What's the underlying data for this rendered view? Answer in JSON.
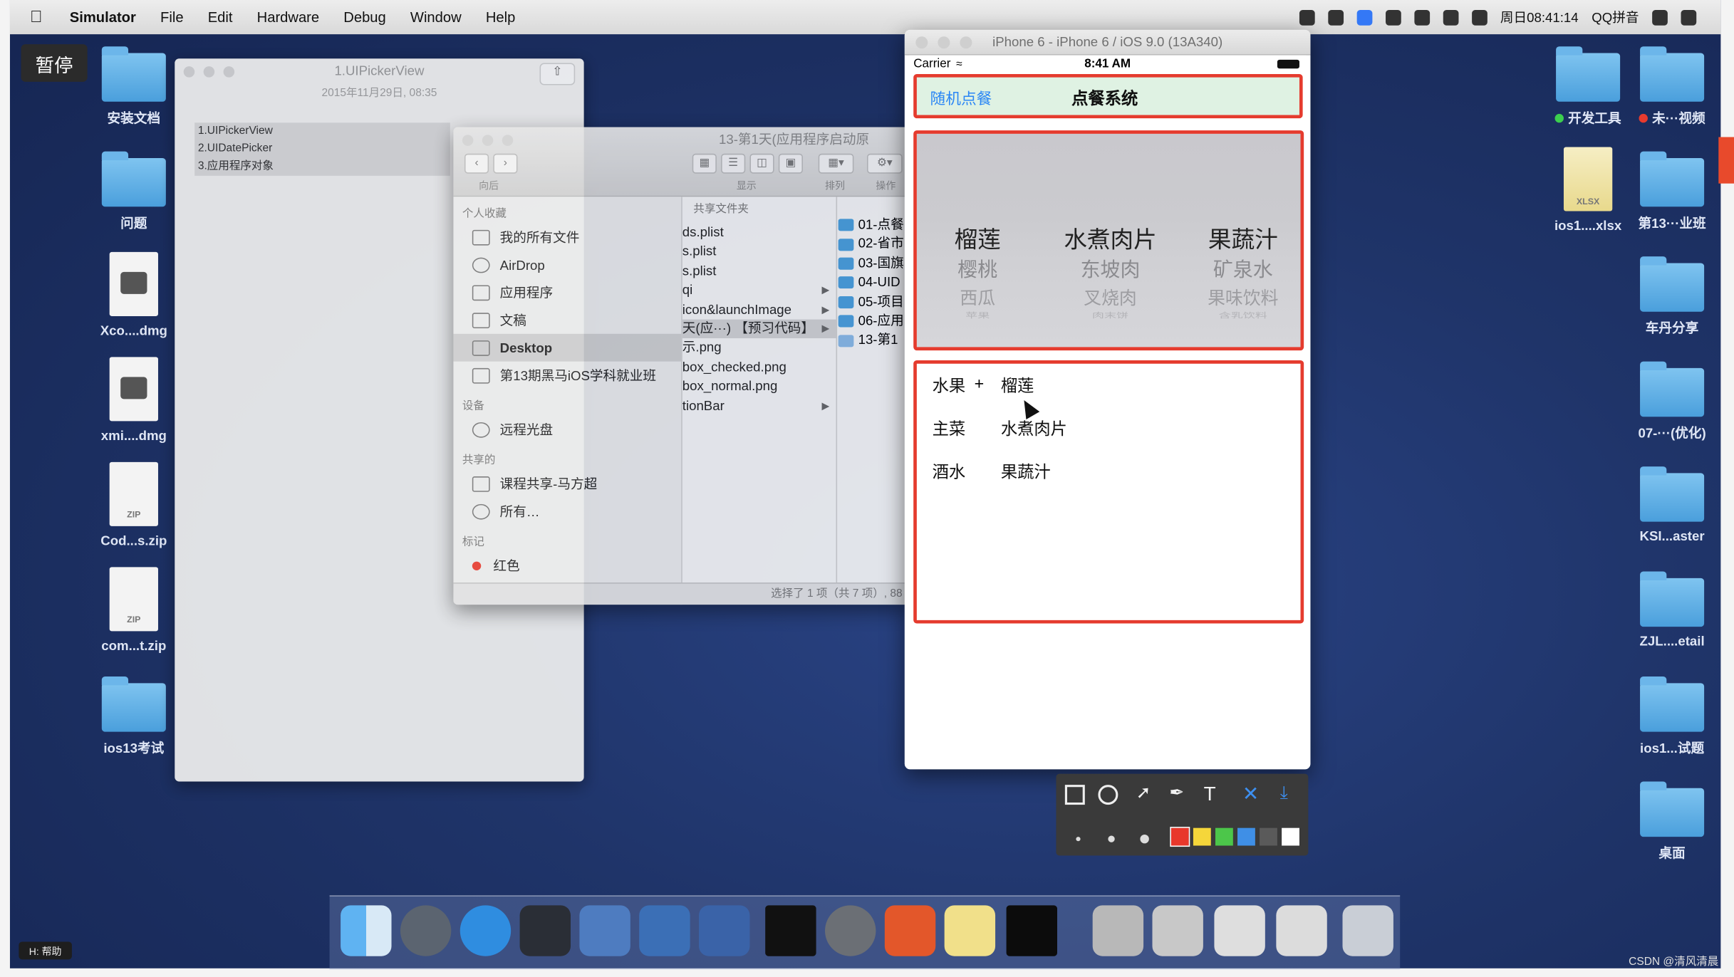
{
  "menubar": {
    "app": "Simulator",
    "items": [
      "File",
      "Edit",
      "Hardware",
      "Debug",
      "Window",
      "Help"
    ],
    "clock": "周日08:41:14",
    "input_method": "QQ拼音"
  },
  "overlay": {
    "pause_label": "暂停",
    "help_label": "H: 帮助"
  },
  "desktop_left": [
    "安装文档",
    "问题",
    "Xco....dmg",
    "xmi....dmg",
    "Cod...s.zip",
    "com...t.zip",
    "ios13考试"
  ],
  "desktop_right": {
    "tag_dev": "开发工具",
    "tag_video": "未···视频",
    "xlsx_icon_label": "XLSX",
    "xlsx_name": "ios1....xlsx",
    "folder_13": "第13···业班",
    "others": [
      "车丹分享",
      "07-···(优化)",
      "KSI...aster",
      "ZJL....etail",
      "ios1...试题",
      "桌面"
    ]
  },
  "notes": {
    "title": "1.UIPickerView",
    "date": "2015年11月29日, 08:35",
    "lines": [
      "1.UIPickerView",
      "2.UIDatePicker",
      "3.应用程序对象"
    ]
  },
  "finder": {
    "title": "13-第1天(应用程序启动原",
    "toolbar_captions": [
      "向后",
      "显示",
      "排列",
      "操作"
    ],
    "favorites_header": "个人收藏",
    "favorites": [
      "我的所有文件",
      "AirDrop",
      "应用程序",
      "文稿",
      "Desktop",
      "第13期黑马iOS学科就业班"
    ],
    "devices_header": "设备",
    "devices": [
      "远程光盘"
    ],
    "shared_header": "共享的",
    "shared": [
      "课程共享-马方超",
      "所有…"
    ],
    "tags_header": "标记",
    "tags": [
      "红色"
    ],
    "column_header": "共享文件夹",
    "col2": [
      "ds.plist",
      "s.plist",
      "s.plist",
      "qi",
      "icon&launchImage",
      "天(应···) 【预习代码】",
      "示.png",
      "box_checked.png",
      "box_normal.png",
      "tionBar"
    ],
    "col3": [
      "01-点餐",
      "02-省市",
      "03-国旗",
      "04-UID",
      "05-项目",
      "06-应用",
      "13-第1"
    ],
    "status": "选择了 1 项（共 7 项）, 88"
  },
  "simulator": {
    "window_title": "iPhone 6 - iPhone 6 / iOS 9.0 (13A340)",
    "carrier": "Carrier",
    "time": "8:41 AM",
    "nav_left": "随机点餐",
    "nav_title": "点餐系统",
    "picker": {
      "columns": [
        {
          "selected": "榴莲",
          "next1": "樱桃",
          "next2": "西瓜",
          "next3": "苹果"
        },
        {
          "selected": "水煮肉片",
          "next1": "东坡肉",
          "next2": "叉烧肉",
          "next3": "肉末饼"
        },
        {
          "selected": "果蔬汁",
          "next1": "矿泉水",
          "next2": "果味饮料",
          "next3": "含乳饮料"
        }
      ]
    },
    "result_rows": [
      {
        "label": "水果",
        "value": "榴莲"
      },
      {
        "label": "主菜",
        "value": "水煮肉片"
      },
      {
        "label": "酒水",
        "value": "果蔬汁"
      }
    ]
  },
  "snip_toolbar": {
    "tools": [
      "rect-tool",
      "ellipse-tool",
      "arrow-tool",
      "brush-tool",
      "text-tool",
      "cancel",
      "save"
    ],
    "colors": [
      "#e8372b",
      "#f5d63a",
      "#4cc64a",
      "#3f8fe6",
      "#5a5a5a",
      "#ffffff"
    ]
  },
  "watermark": "CSDN @清风清晨"
}
